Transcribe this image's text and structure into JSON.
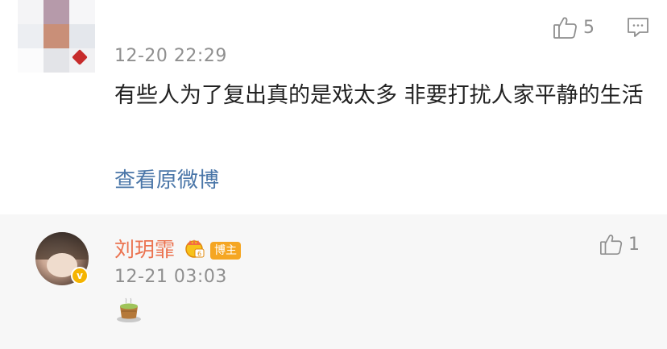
{
  "comment": {
    "timestamp": "12-20 22:29",
    "text": "有些人为了复出真的是戏太多 非要打扰人家平静的生活",
    "view_original_link": "查看原微博",
    "like_count": "5",
    "like_icon": "thumbs-up-icon",
    "reply_icon": "comment-bubble-icon"
  },
  "reply": {
    "username": "刘玥霏",
    "badge_label": "博主",
    "timestamp": "12-21 03:03",
    "emoji": "tea-cup",
    "like_count": "1",
    "verified_badge": "v"
  },
  "colors": {
    "username": "#eb7350",
    "link": "#4a76a8",
    "timestamp": "#8f8f8f",
    "reply_background": "#f7f7f7",
    "host_badge": "#f5a623"
  }
}
